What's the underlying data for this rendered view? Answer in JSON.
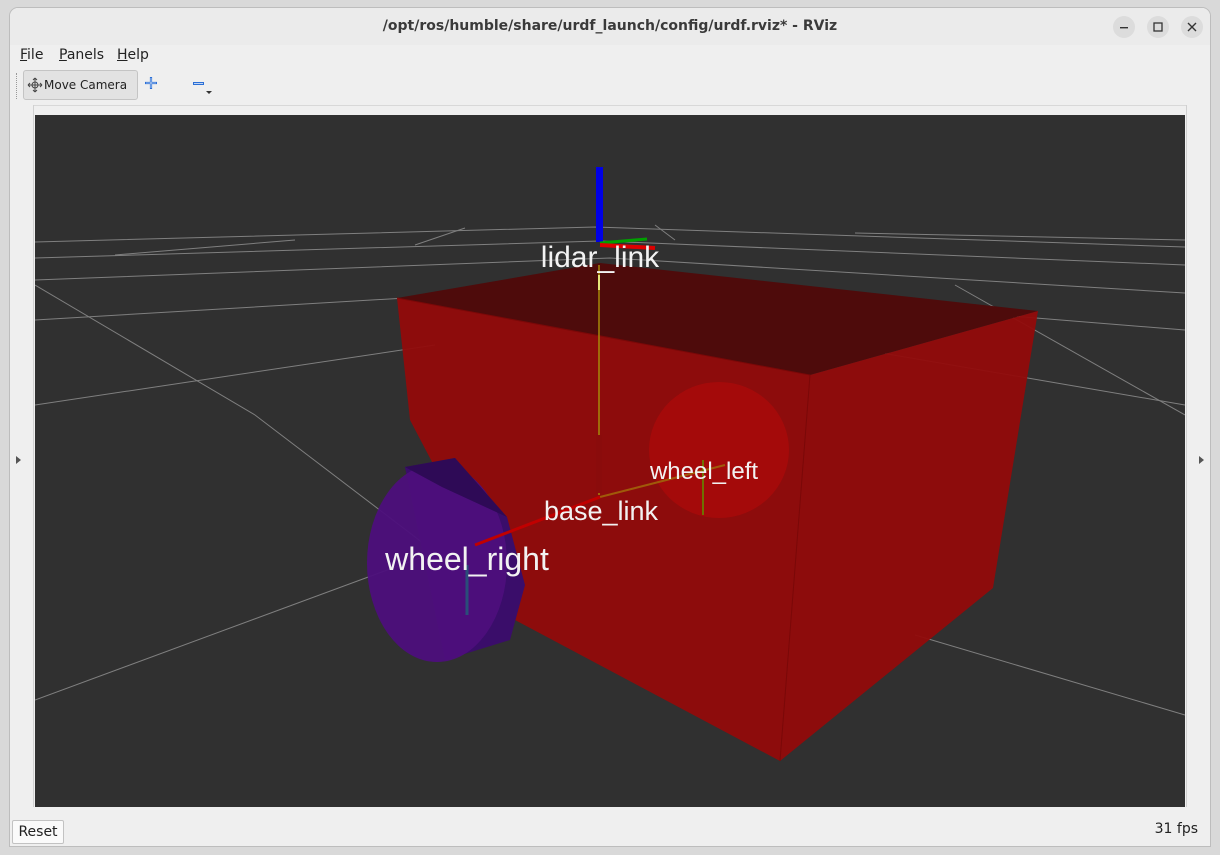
{
  "window": {
    "title": "/opt/ros/humble/share/urdf_launch/config/urdf.rviz* - RViz"
  },
  "menubar": {
    "file": {
      "u": "F",
      "rest": "ile"
    },
    "panels": {
      "u": "P",
      "rest": "anels"
    },
    "help": {
      "u": "H",
      "rest": "elp"
    }
  },
  "toolbar": {
    "move_camera_label": "Move Camera",
    "icons": [
      "move-camera-icon",
      "add-tool-icon",
      "remove-tool-icon"
    ]
  },
  "viewport": {
    "background": "#303030",
    "labels": {
      "lidar": "lidar_link",
      "base": "base_link",
      "wheel_left": "wheel_left",
      "wheel_right": "wheel_right"
    },
    "colors": {
      "body": "#a00e0e",
      "wheel_right": "#4a0f7a",
      "axis_x": "#e00000",
      "axis_y": "#00c000",
      "axis_z": "#0000e0",
      "grid": "#a0a0a0"
    }
  },
  "statusbar": {
    "reset_label": "Reset",
    "fps": "31 fps"
  }
}
